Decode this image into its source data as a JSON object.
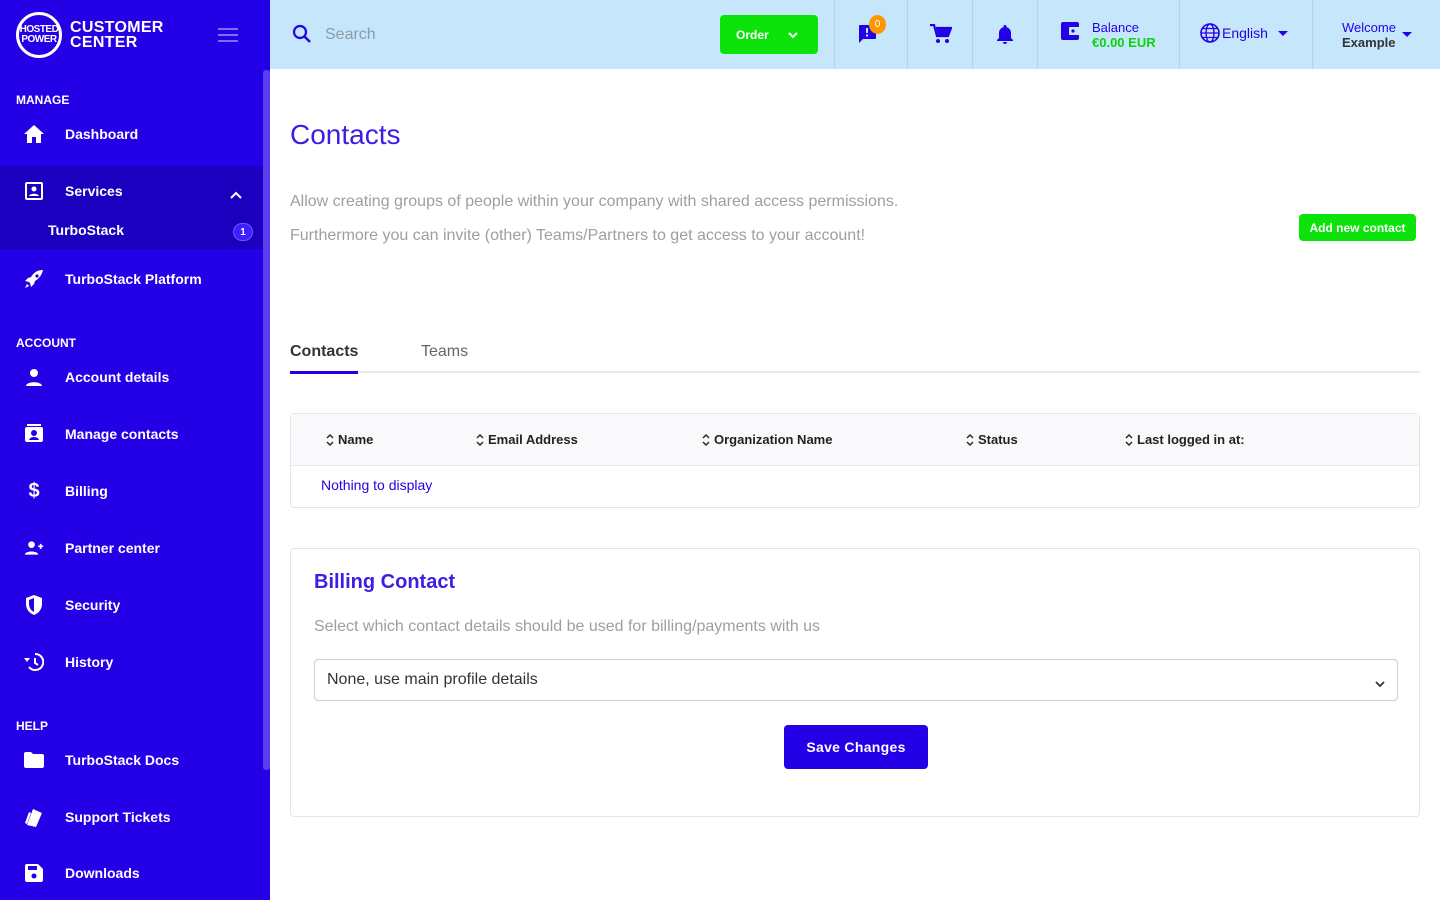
{
  "brand": {
    "logo_text": "HOSTED POWER",
    "title_line1": "CUSTOMER",
    "title_line2": "CENTER"
  },
  "sidebar": {
    "sections": {
      "manage": "MANAGE",
      "account": "ACCOUNT",
      "help": "HELP"
    },
    "items": [
      {
        "label": "Dashboard",
        "icon": "home-icon"
      },
      {
        "label": "Services",
        "icon": "services-icon"
      },
      {
        "label": "TurboStack",
        "badge": "1"
      },
      {
        "label": "TurboStack Platform",
        "icon": "rocket-icon"
      },
      {
        "label": "Account details",
        "icon": "person-icon"
      },
      {
        "label": "Manage contacts",
        "icon": "contacts-icon"
      },
      {
        "label": "Billing",
        "icon": "dollar-icon"
      },
      {
        "label": "Partner center",
        "icon": "partner-icon"
      },
      {
        "label": "Security",
        "icon": "shield-icon"
      },
      {
        "label": "History",
        "icon": "history-icon"
      },
      {
        "label": "TurboStack Docs",
        "icon": "folder-icon"
      },
      {
        "label": "Support Tickets",
        "icon": "tickets-icon"
      },
      {
        "label": "Downloads",
        "icon": "save-icon"
      }
    ]
  },
  "topbar": {
    "search_placeholder": "Search",
    "order_label": "Order",
    "messages_badge": "0",
    "balance_label": "Balance",
    "balance_value": "€0.00 EUR",
    "language": "English",
    "welcome_line1": "Welcome",
    "welcome_line2": "Example"
  },
  "main": {
    "title": "Contacts",
    "description_line1": "Allow creating groups of people within your company with shared access permissions.",
    "description_line2": "Furthermore you can invite (other) Teams/Partners to get access to your account!",
    "add_button": "Add new contact",
    "tabs": [
      {
        "label": "Contacts"
      },
      {
        "label": "Teams"
      }
    ],
    "table": {
      "columns": [
        "Name",
        "Email Address",
        "Organization Name",
        "Status",
        "Last logged in at:"
      ],
      "empty_text": "Nothing to display"
    },
    "billing": {
      "title": "Billing Contact",
      "description": "Select which contact details should be used for billing/payments with us",
      "selected_option": "None, use main profile details",
      "save_button": "Save Changes"
    }
  },
  "colors": {
    "primary": "#2400e6",
    "accent_green": "#0be30b",
    "topbar_bg": "#c6e7fb",
    "badge_orange": "#ff9800"
  }
}
